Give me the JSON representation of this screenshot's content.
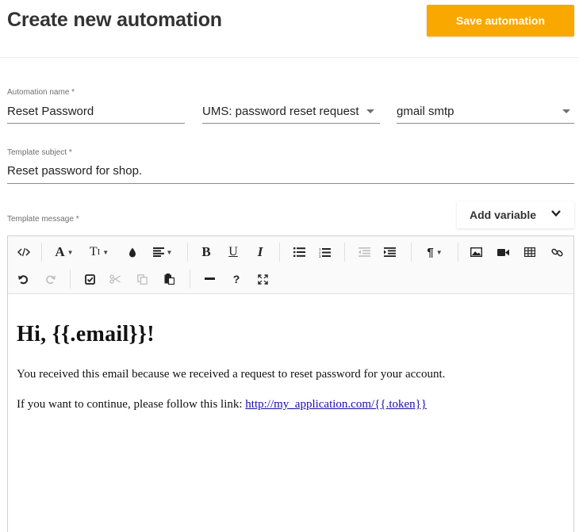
{
  "page": {
    "title": "Create new automation",
    "save_label": "Save automation",
    "accent_color": "#f9a800"
  },
  "form": {
    "automation_name": {
      "label": "Automation name *",
      "value": "Reset Password"
    },
    "event": {
      "value": "UMS: password reset request"
    },
    "smtp": {
      "value": "gmail smtp"
    },
    "template_subject": {
      "label": "Template subject *",
      "value": "Reset password for shop."
    },
    "template_message": {
      "label": "Template message *"
    },
    "add_variable": {
      "label": "Add variable"
    }
  },
  "toolbar": {
    "row1": [
      "code-view-icon",
      "font-color-icon",
      "font-size-icon",
      "highlight-drop-icon",
      "align-icon",
      "bold-icon",
      "underline-icon",
      "italic-icon",
      "bullet-list-icon",
      "numbered-list-icon",
      "outdent-icon",
      "indent-icon",
      "paragraph-format-icon",
      "insert-image-icon",
      "insert-video-icon",
      "insert-table-icon",
      "insert-link-icon"
    ],
    "row2": [
      "undo-icon",
      "redo-icon",
      "select-all-icon",
      "cut-icon",
      "copy-icon",
      "paste-icon",
      "horizontal-line-icon",
      "help-icon",
      "fullscreen-icon"
    ],
    "glyphs": {
      "font": "A",
      "size": "T",
      "bold": "B",
      "underline": "U",
      "italic": "I",
      "help": "?"
    }
  },
  "message": {
    "greeting": "Hi, {{.email}}!",
    "line1": "You received this email because we received a request to reset password for your account.",
    "line2_prefix": "If you want to continue, please follow this link: ",
    "link_text": "http://my_application.com/{{.token}}"
  }
}
